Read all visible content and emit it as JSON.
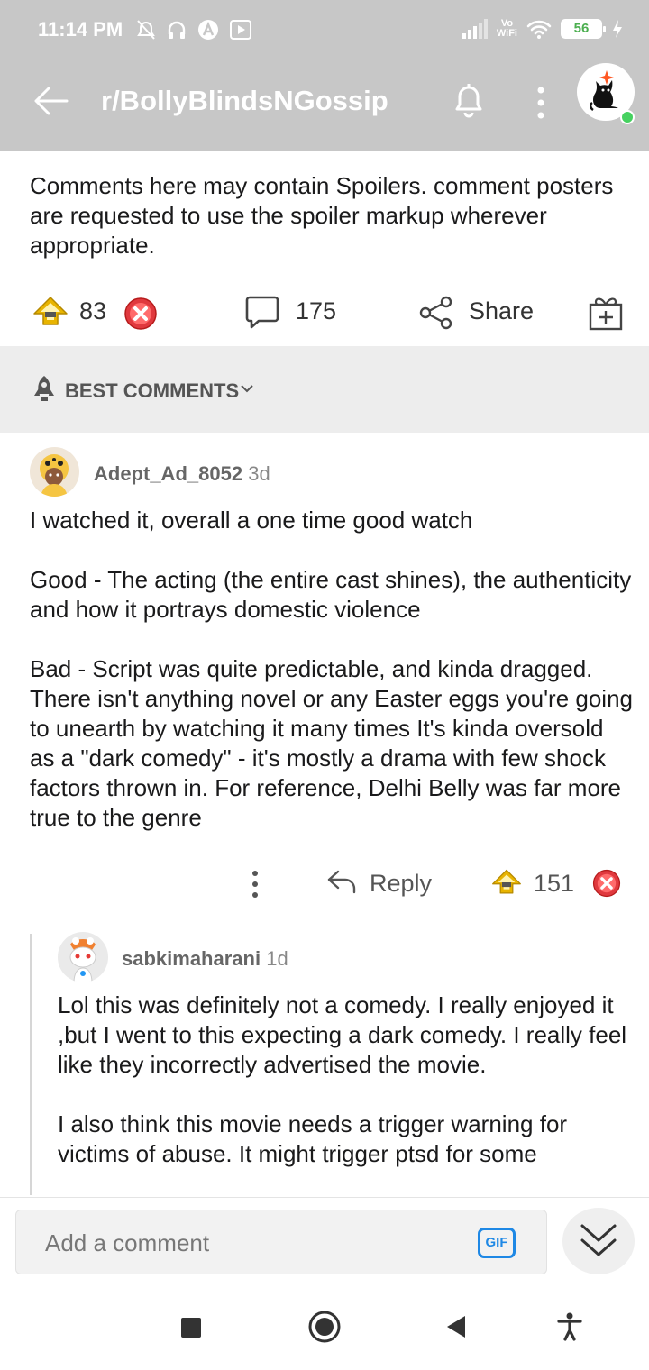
{
  "status_bar": {
    "time": "11:14 PM",
    "vowifi_top": "Vo",
    "vowifi_bottom": "WiFi",
    "battery": "56"
  },
  "app_bar": {
    "subreddit": "r/BollyBlindsNGossip"
  },
  "post": {
    "body": "Comments here may contain Spoilers. comment posters are requested to use the  spoiler markup wherever appropriate.",
    "score": "83",
    "comment_count": "175",
    "share_label": "Share"
  },
  "sort": {
    "label": "BEST COMMENTS"
  },
  "comments": [
    {
      "username": "Adept_Ad_8052",
      "age": "3d",
      "paragraphs": [
        "I watched it, overall a one time good watch",
        "Good - The acting (the entire cast shines), the authenticity and how it portrays domestic violence",
        "Bad - Script was quite predictable, and kinda dragged. There isn't anything novel or any Easter eggs you're going to unearth by watching it many times It's kinda oversold as a \"dark comedy\" - it's mostly a drama with few shock factors thrown in. For reference, Delhi Belly was far more true to the genre"
      ],
      "reply_label": "Reply",
      "score": "151"
    },
    {
      "username": "sabkimaharani",
      "age": "1d",
      "paragraphs": [
        "Lol this was definitely not a comedy. I really enjoyed it ,but I went to this expecting a dark comedy. I really feel like they incorrectly advertised the movie.",
        "I also think this movie needs a trigger warning for victims of abuse. It might trigger ptsd for some"
      ]
    }
  ],
  "composer": {
    "placeholder": "Add a comment",
    "gif_label": "GIF"
  },
  "colors": {
    "topbar": "#c7c7c7",
    "upvote_gold": "#e8b400",
    "downvote_red": "#e0393e",
    "gif_blue": "#1e88e5",
    "online_green": "#46d160"
  },
  "icons": [
    "back-arrow-icon",
    "bell-icon",
    "overflow-menu-icon",
    "upvote-icon",
    "downvote-icon",
    "comment-icon",
    "share-icon",
    "gift-icon",
    "rocket-icon",
    "chevron-down-icon",
    "reply-icon",
    "collapse-chevron-icon",
    "nav-square-icon",
    "nav-home-icon",
    "nav-back-icon",
    "accessibility-icon"
  ]
}
